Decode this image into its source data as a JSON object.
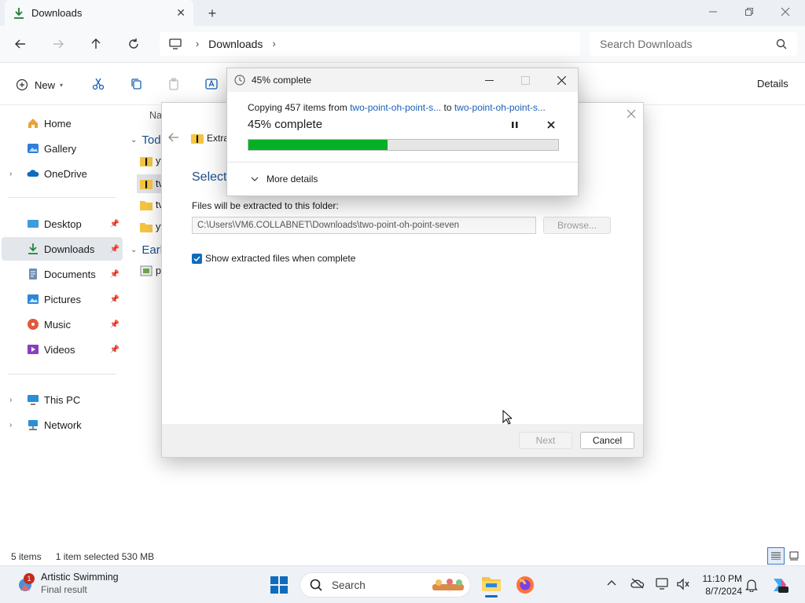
{
  "window": {
    "tab_title": "Downloads"
  },
  "address": {
    "crumb": "Downloads",
    "search_placeholder": "Search Downloads"
  },
  "command": {
    "new_label": "New",
    "details_label": "Details"
  },
  "sidebar": {
    "items": [
      {
        "label": "Home"
      },
      {
        "label": "Gallery"
      },
      {
        "label": "OneDrive"
      },
      {
        "label": "Desktop"
      },
      {
        "label": "Downloads"
      },
      {
        "label": "Documents"
      },
      {
        "label": "Pictures"
      },
      {
        "label": "Music"
      },
      {
        "label": "Videos"
      },
      {
        "label": "This PC"
      },
      {
        "label": "Network"
      }
    ]
  },
  "content": {
    "col_name": "Na",
    "group_today": "Tod",
    "group_earlier": "Earl",
    "rows": [
      "yt",
      "tv",
      "tv",
      "yt",
      "p"
    ]
  },
  "status": {
    "items": "5 items",
    "selected": "1 item selected  530 MB"
  },
  "extract": {
    "crumb": "Extra",
    "heading": "Select",
    "folder_label": "Files will be extracted to this folder:",
    "path": "C:\\Users\\VM6.COLLABNET\\Downloads\\two-point-oh-point-seven",
    "browse": "Browse...",
    "show_files": "Show extracted files when complete",
    "show_files_checked": true,
    "next": "Next",
    "cancel": "Cancel"
  },
  "progress": {
    "title": "45% complete",
    "copying_prefix": "Copying 457 items from",
    "source": "two-point-oh-point-s...",
    "to": "to",
    "dest": "two-point-oh-point-s...",
    "headline": "45% complete",
    "percent": 45,
    "more_details": "More details",
    "bar_color": "#06b025"
  },
  "taskbar": {
    "widget_title": "Artistic Swimming",
    "widget_sub": "Final result",
    "badge": "1",
    "search": "Search",
    "time": "11:10 PM",
    "date": "8/7/2024"
  }
}
